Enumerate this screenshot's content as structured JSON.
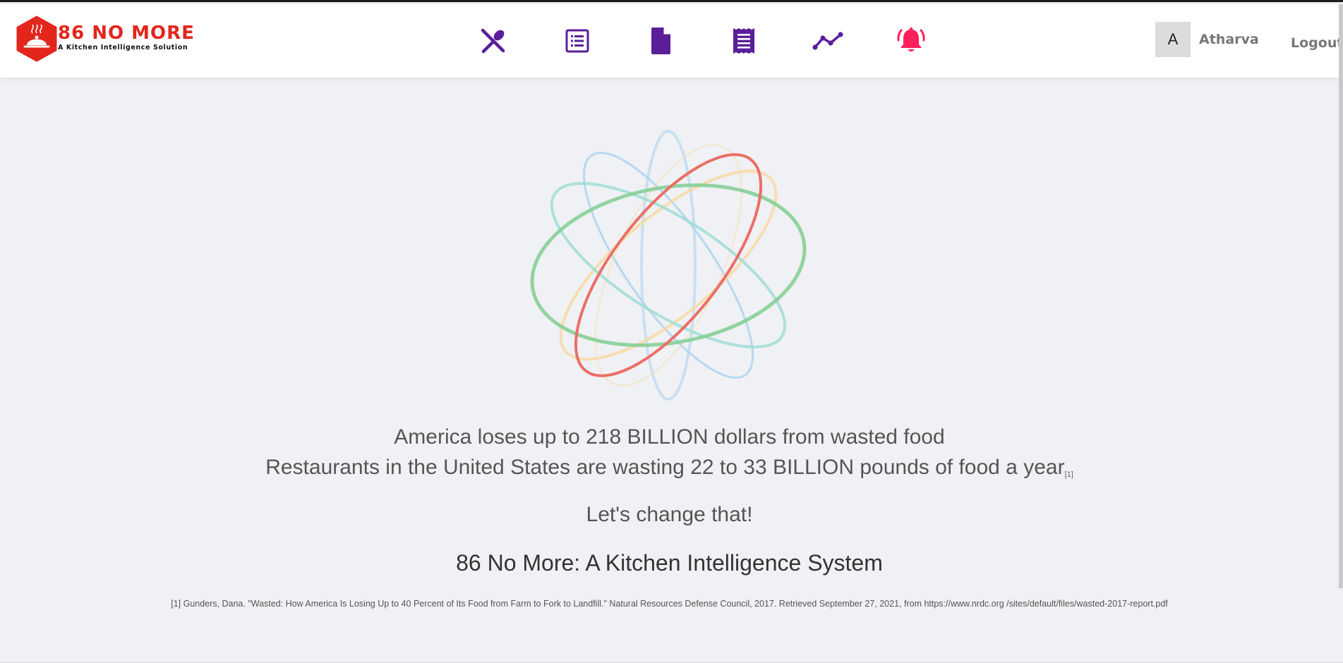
{
  "brand": {
    "title": "86 NO MORE",
    "subtitle": "A Kitchen Intelligence Solution",
    "color": "#e3261c"
  },
  "nav": {
    "items": [
      {
        "name": "menu",
        "icon": "fork-spoon-icon",
        "color": "#5a1e9b"
      },
      {
        "name": "inventory",
        "icon": "list-icon",
        "color": "#5a1e9b"
      },
      {
        "name": "documents",
        "icon": "document-icon",
        "color": "#5a1e9b"
      },
      {
        "name": "receipts",
        "icon": "receipt-icon",
        "color": "#5a1e9b"
      },
      {
        "name": "analytics",
        "icon": "trend-line-icon",
        "color": "#5a1e9b"
      },
      {
        "name": "alerts",
        "icon": "bell-icon",
        "color": "#ff1f5a"
      }
    ]
  },
  "user": {
    "initial": "A",
    "name": "Atharva",
    "logout_label": "Logout"
  },
  "hero": {
    "line1": "America loses up to 218 BILLION dollars from wasted food",
    "line2": "Restaurants in the United States are wasting 22 to 33 BILLION pounds of food a year",
    "line2_ref": "[1]",
    "line3": "Let's change that!",
    "line4": "86 No More: A Kitchen Intelligence System"
  },
  "citation": {
    "text": "[1] Gunders, Dana. \"Wasted: How America Is Losing Up to 40 Percent of Its Food from Farm to Fork to Landfill.\" Natural Resources Defense Council, 2017. Retrieved September 27, 2021, from https://www.nrdc.org /sites/default/files/wasted-2017-report.pdf"
  },
  "orbit_colors": {
    "red": "#ec6e66",
    "green": "#86cf96",
    "blue": "#a8d2ef",
    "yellow": "#f7d9a3",
    "teal": "#9fddd5"
  }
}
